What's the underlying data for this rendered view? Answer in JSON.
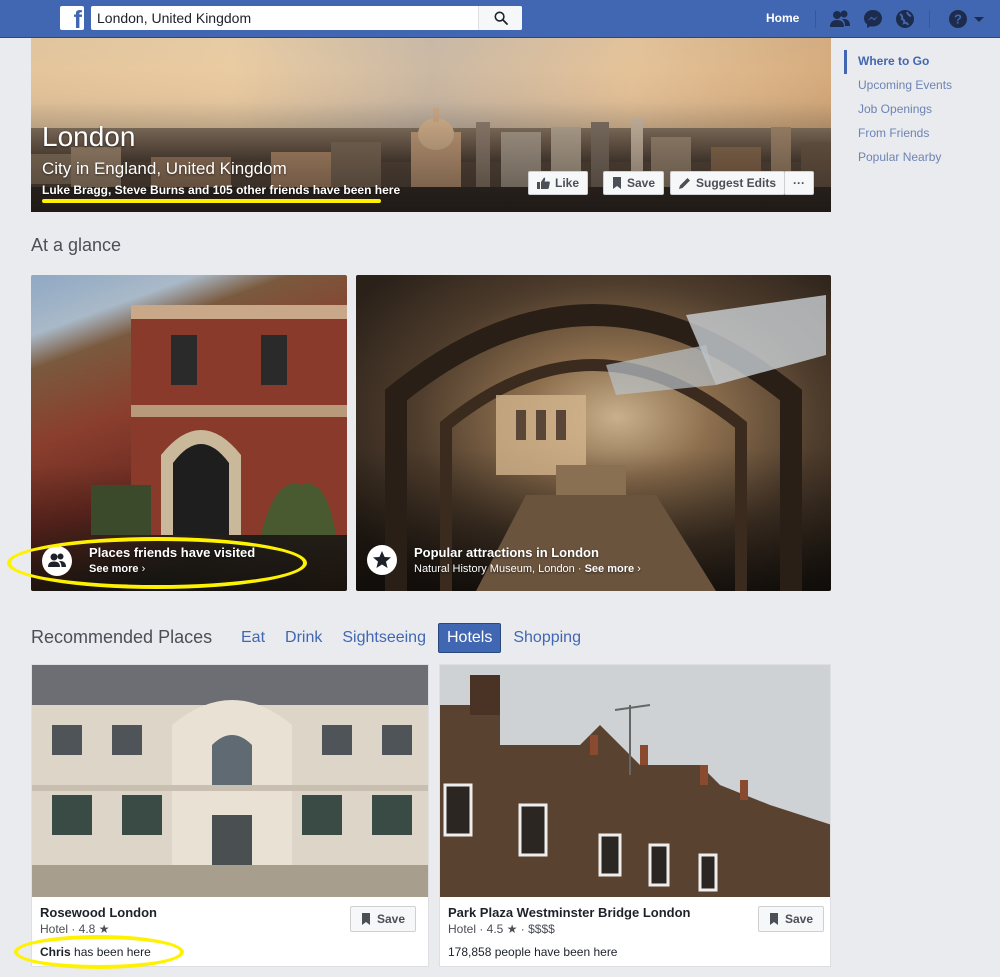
{
  "topbar": {
    "logo": "f",
    "search_value": "London, United Kingdom",
    "home_label": "Home",
    "icons": [
      "friends-icon",
      "messenger-icon",
      "globe-icon",
      "help-icon",
      "dropdown-arrow-icon"
    ],
    "color": "#4267b2"
  },
  "cover": {
    "title": "London",
    "subtitle": "City in England, United Kingdom",
    "friends_text": "Luke Bragg, Steve Burns and 105 other friends have been here",
    "buttons": {
      "like": "Like",
      "save": "Save",
      "suggest": "Suggest Edits",
      "more": "···"
    }
  },
  "right_nav": {
    "items": [
      {
        "label": "Where to Go",
        "active": true
      },
      {
        "label": "Upcoming Events",
        "active": false
      },
      {
        "label": "Job Openings",
        "active": false
      },
      {
        "label": "From Friends",
        "active": false
      },
      {
        "label": "Popular Nearby",
        "active": false
      }
    ]
  },
  "glance": {
    "heading": "At a glance",
    "cards": [
      {
        "title": "Places friends have visited",
        "subtitle": "",
        "see_more": "See more"
      },
      {
        "title": "Popular attractions in London",
        "subtitle": "Natural History Museum, London · ",
        "see_more": "See more"
      }
    ]
  },
  "recommended": {
    "heading": "Recommended Places",
    "tabs": [
      {
        "label": "Eat",
        "active": false
      },
      {
        "label": "Drink",
        "active": false
      },
      {
        "label": "Sightseeing",
        "active": false
      },
      {
        "label": "Hotels",
        "active": true
      },
      {
        "label": "Shopping",
        "active": false
      }
    ],
    "places": [
      {
        "name": "Rosewood London",
        "meta": "Hotel · 4.8 ★",
        "social_bold": "Chris",
        "social_rest": " has been here",
        "save": "Save"
      },
      {
        "name": "Park Plaza Westminster Bridge London",
        "meta": "Hotel · 4.5 ★ · $$$$",
        "social_bold": "",
        "social_rest": "178,858 people have been here",
        "save": "Save"
      }
    ]
  },
  "colors": {
    "highlight": "#fff200",
    "link": "#4267b2",
    "background": "#e9ebee"
  }
}
